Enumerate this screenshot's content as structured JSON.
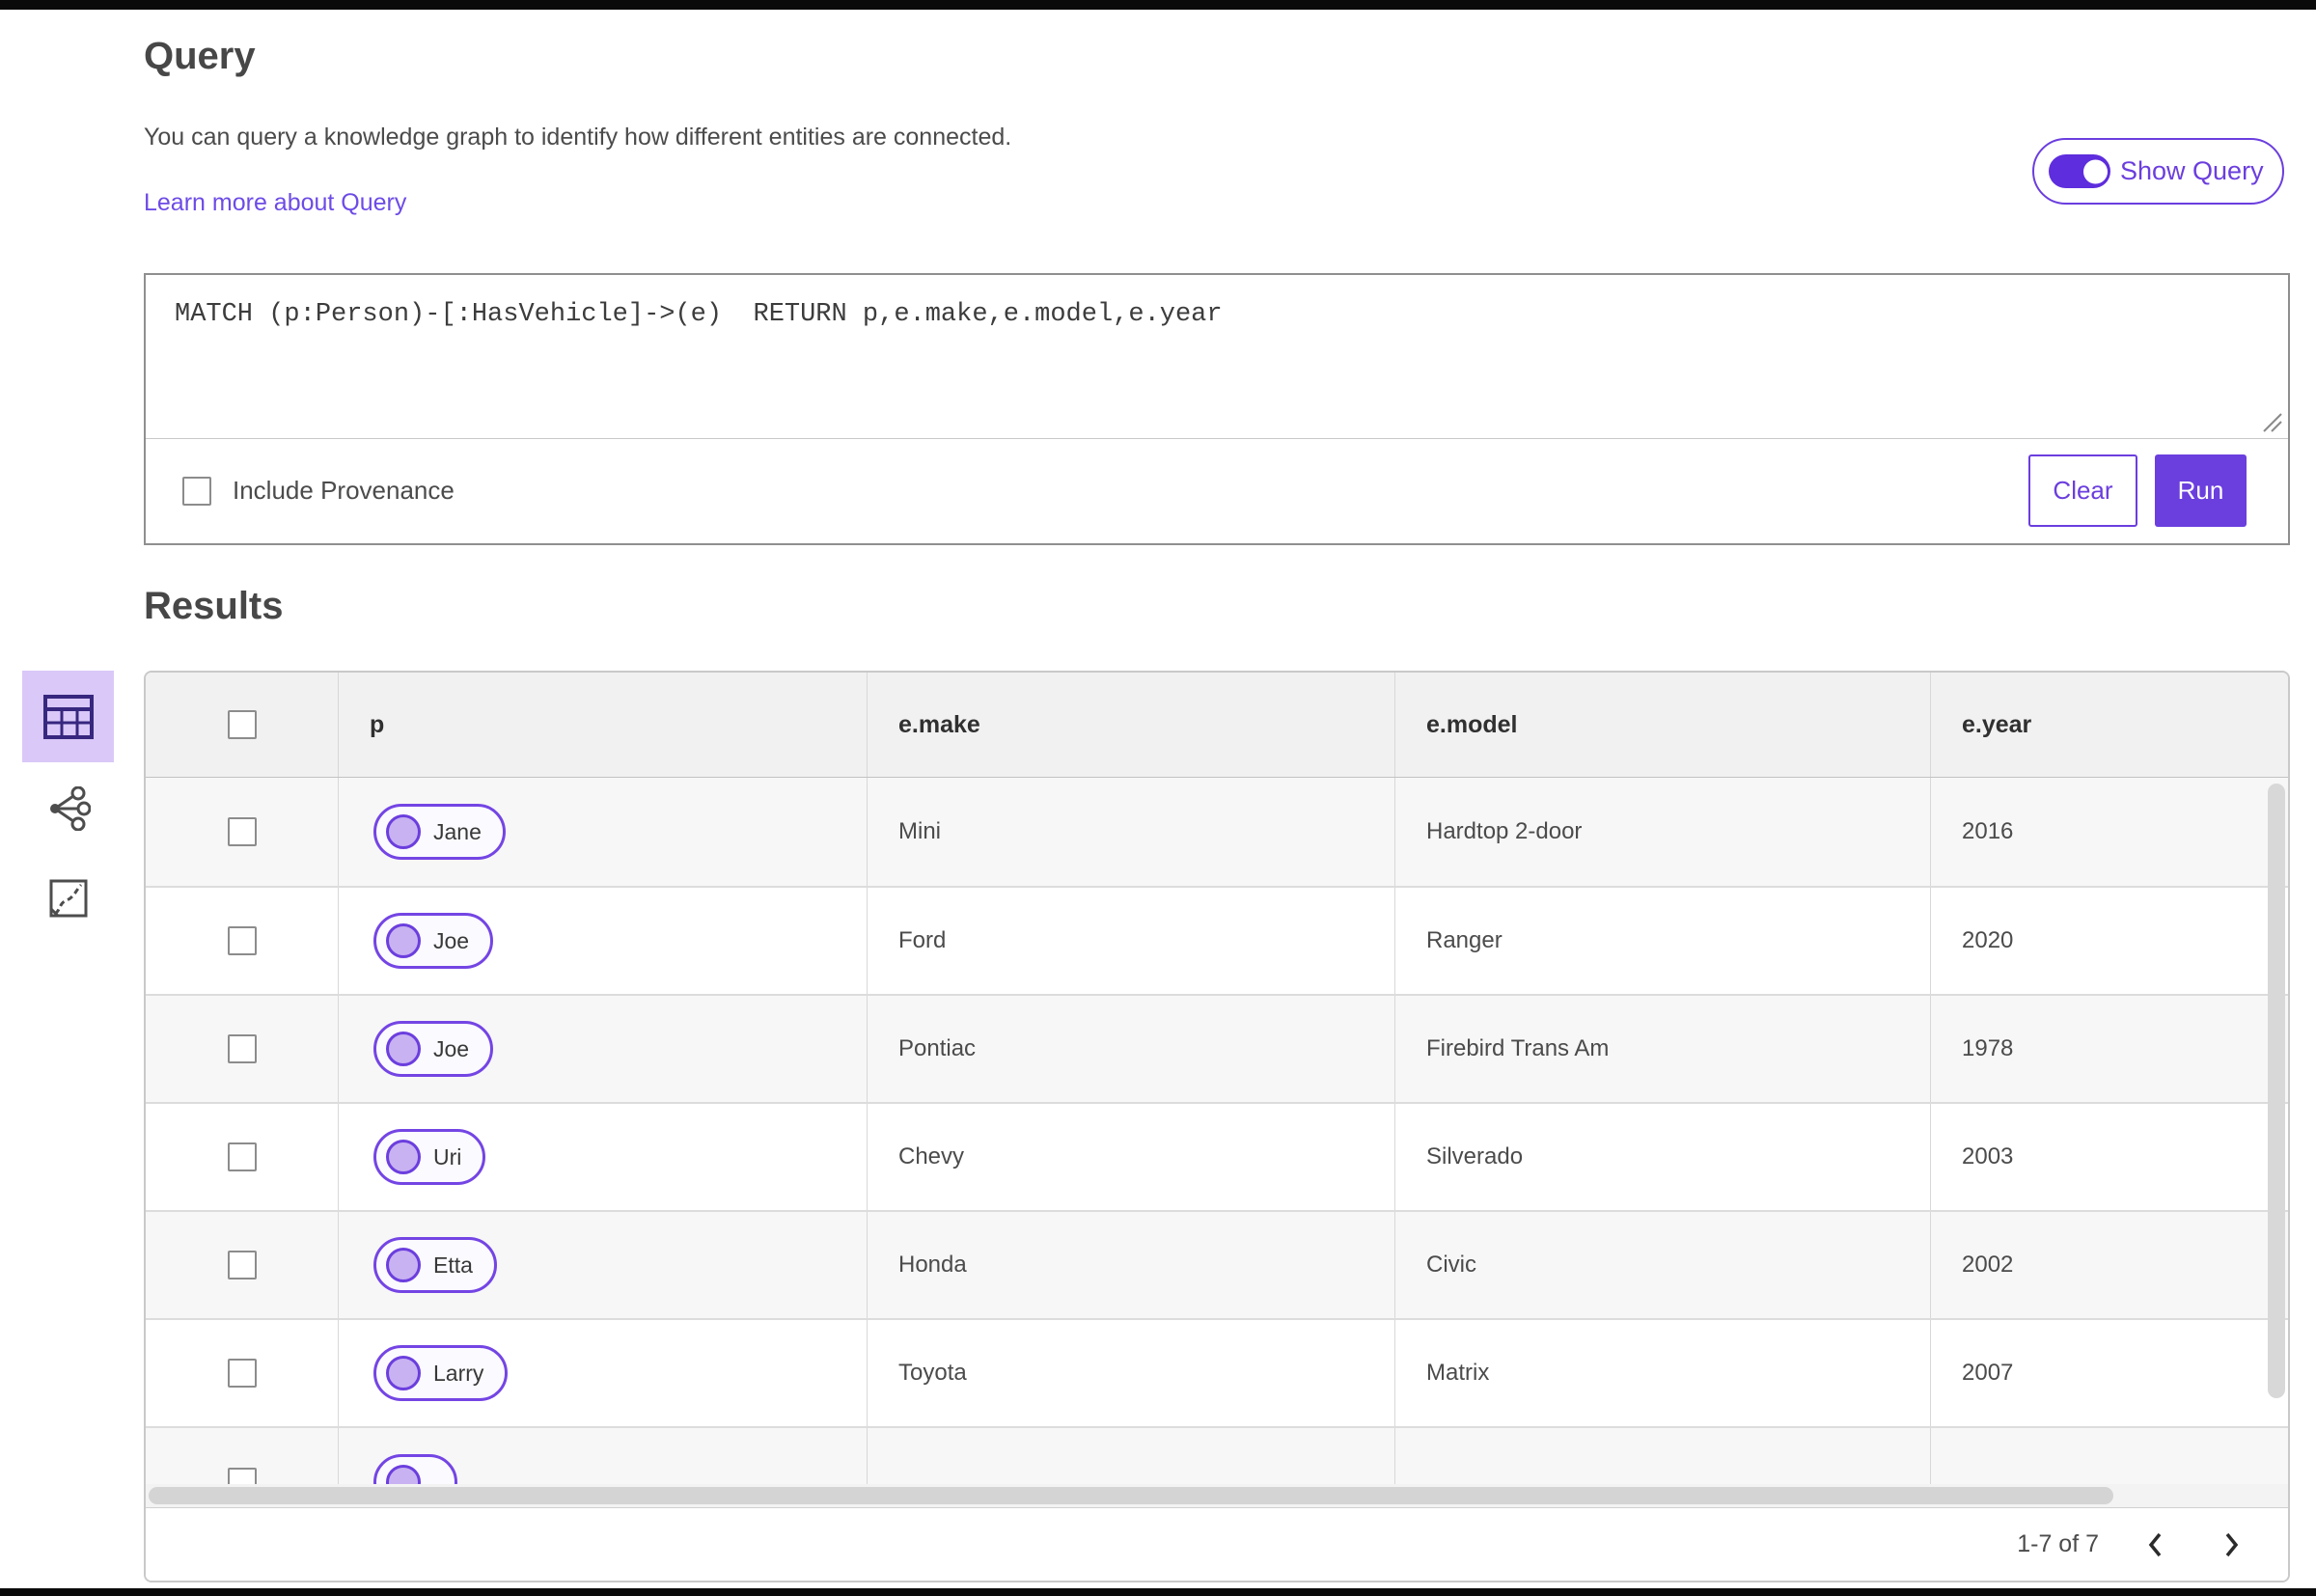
{
  "colors": {
    "accent": "#6b3ede",
    "accent_light_bg": "#d9c8f8",
    "link": "#6d4be6"
  },
  "query_panel": {
    "title": "Query",
    "description": "You can query a knowledge graph to identify how different entities are connected.",
    "learn_more_link": "Learn more about Query",
    "show_query_toggle": {
      "label": "Show Query",
      "state": "on"
    },
    "query_editor": {
      "value": "MATCH (p:Person)-[:HasVehicle]->(e)  RETURN p,e.make,e.model,e.year"
    },
    "include_provenance": {
      "label": "Include Provenance",
      "checked": false
    },
    "buttons": {
      "clear": "Clear",
      "run": "Run"
    }
  },
  "results_panel": {
    "title": "Results",
    "view_switcher": {
      "items": [
        {
          "name": "table-view",
          "icon": "table-icon",
          "selected": true
        },
        {
          "name": "link-chart-view",
          "icon": "link-chart-icon",
          "selected": false
        },
        {
          "name": "map-view",
          "icon": "map-icon",
          "selected": false
        }
      ]
    },
    "table": {
      "columns": [
        "p",
        "e.make",
        "e.model",
        "e.year"
      ],
      "select_all_checked": false,
      "rows": [
        {
          "selected": false,
          "p": "Jane",
          "make": "Mini",
          "model": "Hardtop 2-door",
          "year": "2016"
        },
        {
          "selected": false,
          "p": "Joe",
          "make": "Ford",
          "model": "Ranger",
          "year": "2020"
        },
        {
          "selected": false,
          "p": "Joe",
          "make": "Pontiac",
          "model": "Firebird Trans Am",
          "year": "1978"
        },
        {
          "selected": false,
          "p": "Uri",
          "make": "Chevy",
          "model": "Silverado",
          "year": "2003"
        },
        {
          "selected": false,
          "p": "Etta",
          "make": "Honda",
          "model": "Civic",
          "year": "2002"
        },
        {
          "selected": false,
          "p": "Larry",
          "make": "Toyota",
          "model": "Matrix",
          "year": "2007"
        }
      ],
      "partial_row_visible": true
    },
    "pagination": {
      "range_label": "1-7 of 7",
      "prev_icon": "chevron-left-icon",
      "next_icon": "chevron-right-icon"
    }
  }
}
